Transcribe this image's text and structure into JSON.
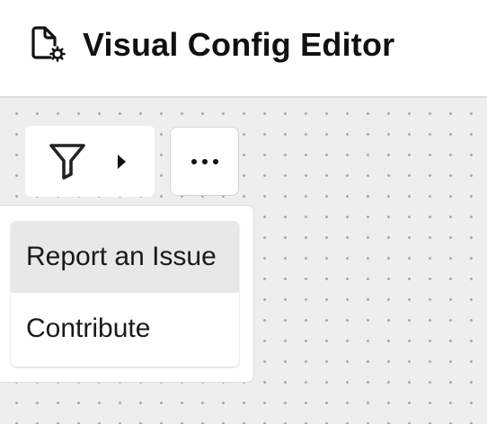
{
  "header": {
    "title": "Visual Config Editor",
    "icon": "file-gear-icon"
  },
  "toolbar": {
    "filter_icon": "filter-icon",
    "expand_icon": "caret-right-icon",
    "more_icon": "more-horizontal-icon"
  },
  "menu": {
    "items": [
      {
        "label": "Report an Issue",
        "active": true
      },
      {
        "label": "Contribute",
        "active": false
      }
    ]
  },
  "colors": {
    "canvas_bg": "#eeeeee",
    "grid_dot": "#a7a7a7",
    "text": "#111111",
    "active_item_bg": "#e8e8e8"
  }
}
